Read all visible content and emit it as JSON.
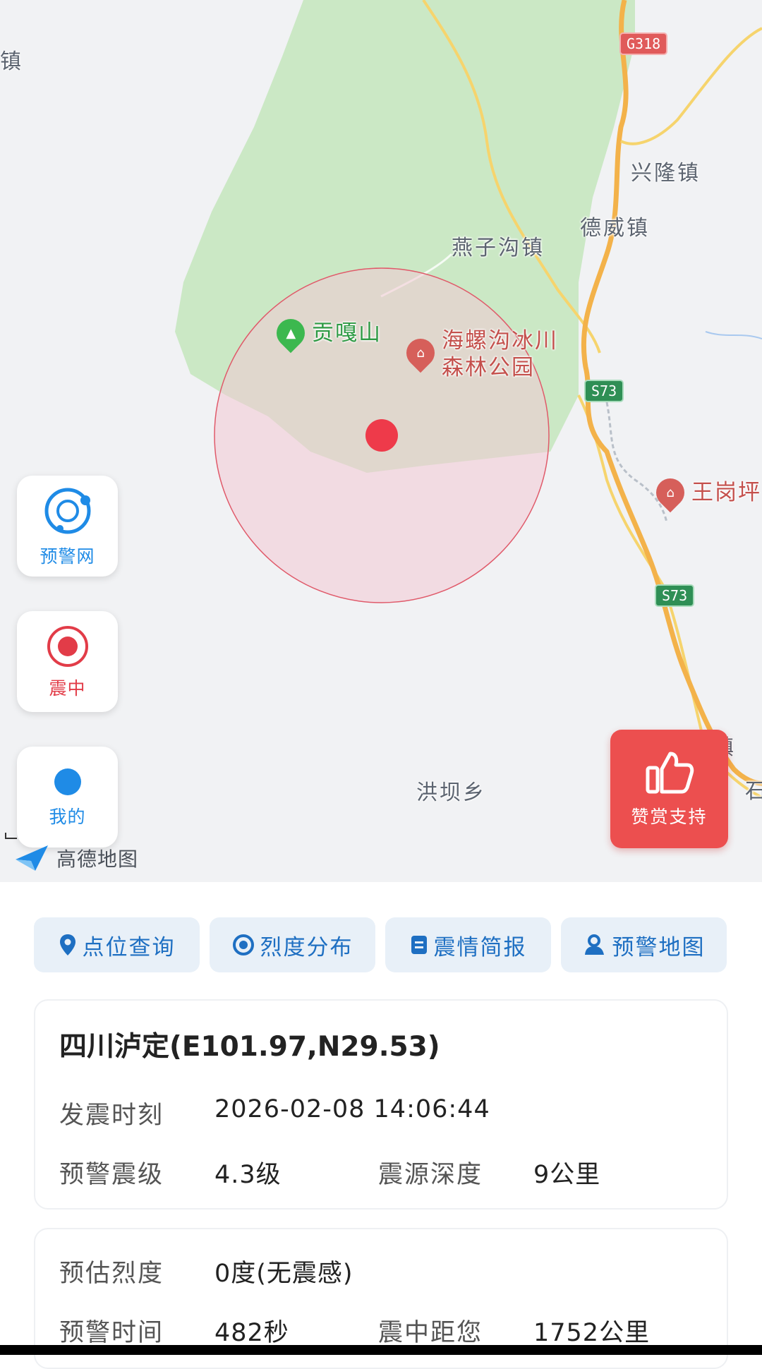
{
  "map": {
    "places": {
      "xinglong": "兴隆镇",
      "dewei": "德威镇",
      "yanzigou": "燕子沟镇",
      "hongba": "洪坝乡",
      "edge_top_left": "镇",
      "edge_right_1": "镇",
      "edge_right_2": "石"
    },
    "roads": {
      "g318": "G318",
      "s73_a": "S73",
      "s73_b": "S73"
    },
    "pois": {
      "gongga": "贡嘎山",
      "hailuogou_line1": "海螺沟冰川",
      "hailuogou_line2": "森林公园",
      "wanggangping": "王岗坪"
    },
    "colors": {
      "epicenter": "#ee3a4a",
      "forest": "#c7e7c0",
      "radius_fill": "#f3c8d3"
    },
    "attribution": "高德地图"
  },
  "side_buttons": {
    "network": {
      "label": "预警网",
      "icon": "network-orbit-icon"
    },
    "epicenter": {
      "label": "震中",
      "icon": "target-icon"
    },
    "mine": {
      "label": "我的",
      "icon": "location-dot-icon"
    }
  },
  "reward": {
    "label": "赞赏支持",
    "icon": "thumbs-up-icon"
  },
  "tabs": [
    {
      "label": "点位查询",
      "icon": "pin-icon"
    },
    {
      "label": "烈度分布",
      "icon": "circle-dot-icon"
    },
    {
      "label": "震情简报",
      "icon": "report-icon"
    },
    {
      "label": "预警地图",
      "icon": "map-person-icon"
    }
  ],
  "quake": {
    "title": "四川泸定(E101.97,N29.53)",
    "time_label": "发震时刻",
    "time_value": "2026-02-08 14:06:44",
    "magnitude_label": "预警震级",
    "magnitude_value": "4.3级",
    "depth_label": "震源深度",
    "depth_value": "9公里",
    "intensity_label": "预估烈度",
    "intensity_value": "0度(无震感)",
    "warning_time_label": "预警时间",
    "warning_time_value": "482秒",
    "distance_label": "震中距您",
    "distance_value": "1752公里"
  }
}
